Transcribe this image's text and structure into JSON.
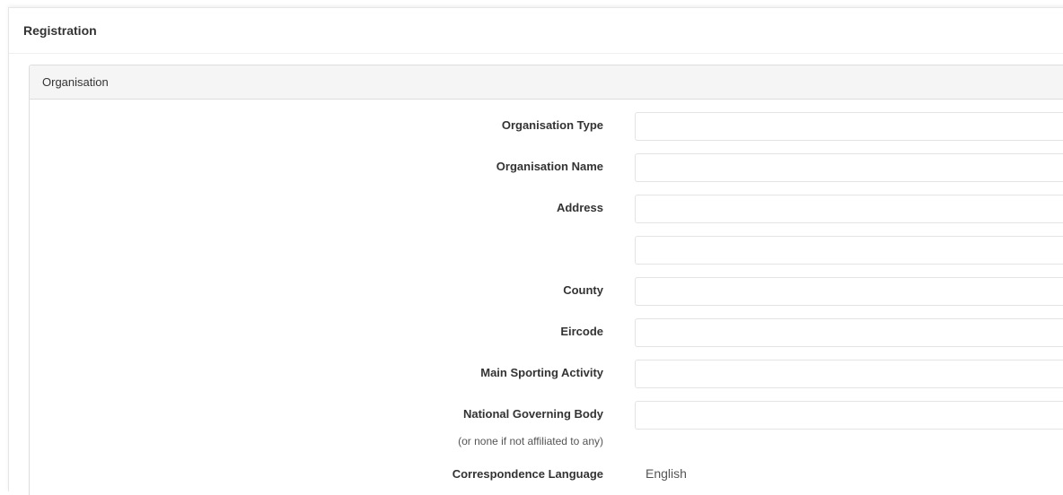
{
  "panel": {
    "title": "Registration"
  },
  "section": {
    "title": "Organisation"
  },
  "form": {
    "organisation_type": {
      "label": "Organisation Type",
      "value": ""
    },
    "organisation_name": {
      "label": "Organisation Name",
      "value": ""
    },
    "address": {
      "label": "Address",
      "line1": "",
      "line2": ""
    },
    "county": {
      "label": "County",
      "value": ""
    },
    "eircode": {
      "label": "Eircode",
      "value": ""
    },
    "main_sporting_activity": {
      "label": "Main Sporting Activity",
      "value": ""
    },
    "national_governing_body": {
      "label": "National Governing Body",
      "note": "(or none if not affiliated to any)",
      "value": ""
    },
    "correspondence_language": {
      "label": "Correspondence Language",
      "value": "English"
    }
  }
}
